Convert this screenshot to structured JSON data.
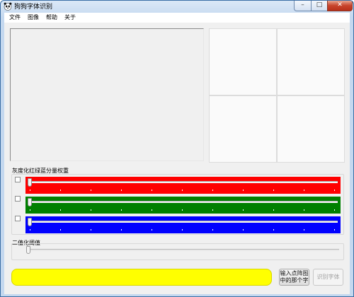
{
  "window": {
    "title": "狗狗字体识别",
    "min_glyph": "–",
    "max_glyph": "□",
    "close_glyph": "✕"
  },
  "menu": [
    {
      "label": "文件"
    },
    {
      "label": "图像"
    },
    {
      "label": "帮助"
    },
    {
      "label": "关于"
    }
  ],
  "grayscale_group": {
    "label": "灰度化红绿蓝分量权重",
    "sliders": [
      {
        "name": "red",
        "color": "#ff0000",
        "value": 0,
        "checked": false
      },
      {
        "name": "green",
        "color": "#008000",
        "value": 0,
        "checked": false
      },
      {
        "name": "blue",
        "color": "#0000ff",
        "value": 0,
        "checked": false
      }
    ]
  },
  "threshold_group": {
    "label": "二值化阈值",
    "value": 0
  },
  "text_input": {
    "value": "",
    "color": "#ffff00"
  },
  "buttons": {
    "input_char_line1": "输入点阵图",
    "input_char_line2": "中的那个字",
    "recognize": "识别字体"
  },
  "icons": {
    "app": "panda-icon"
  }
}
